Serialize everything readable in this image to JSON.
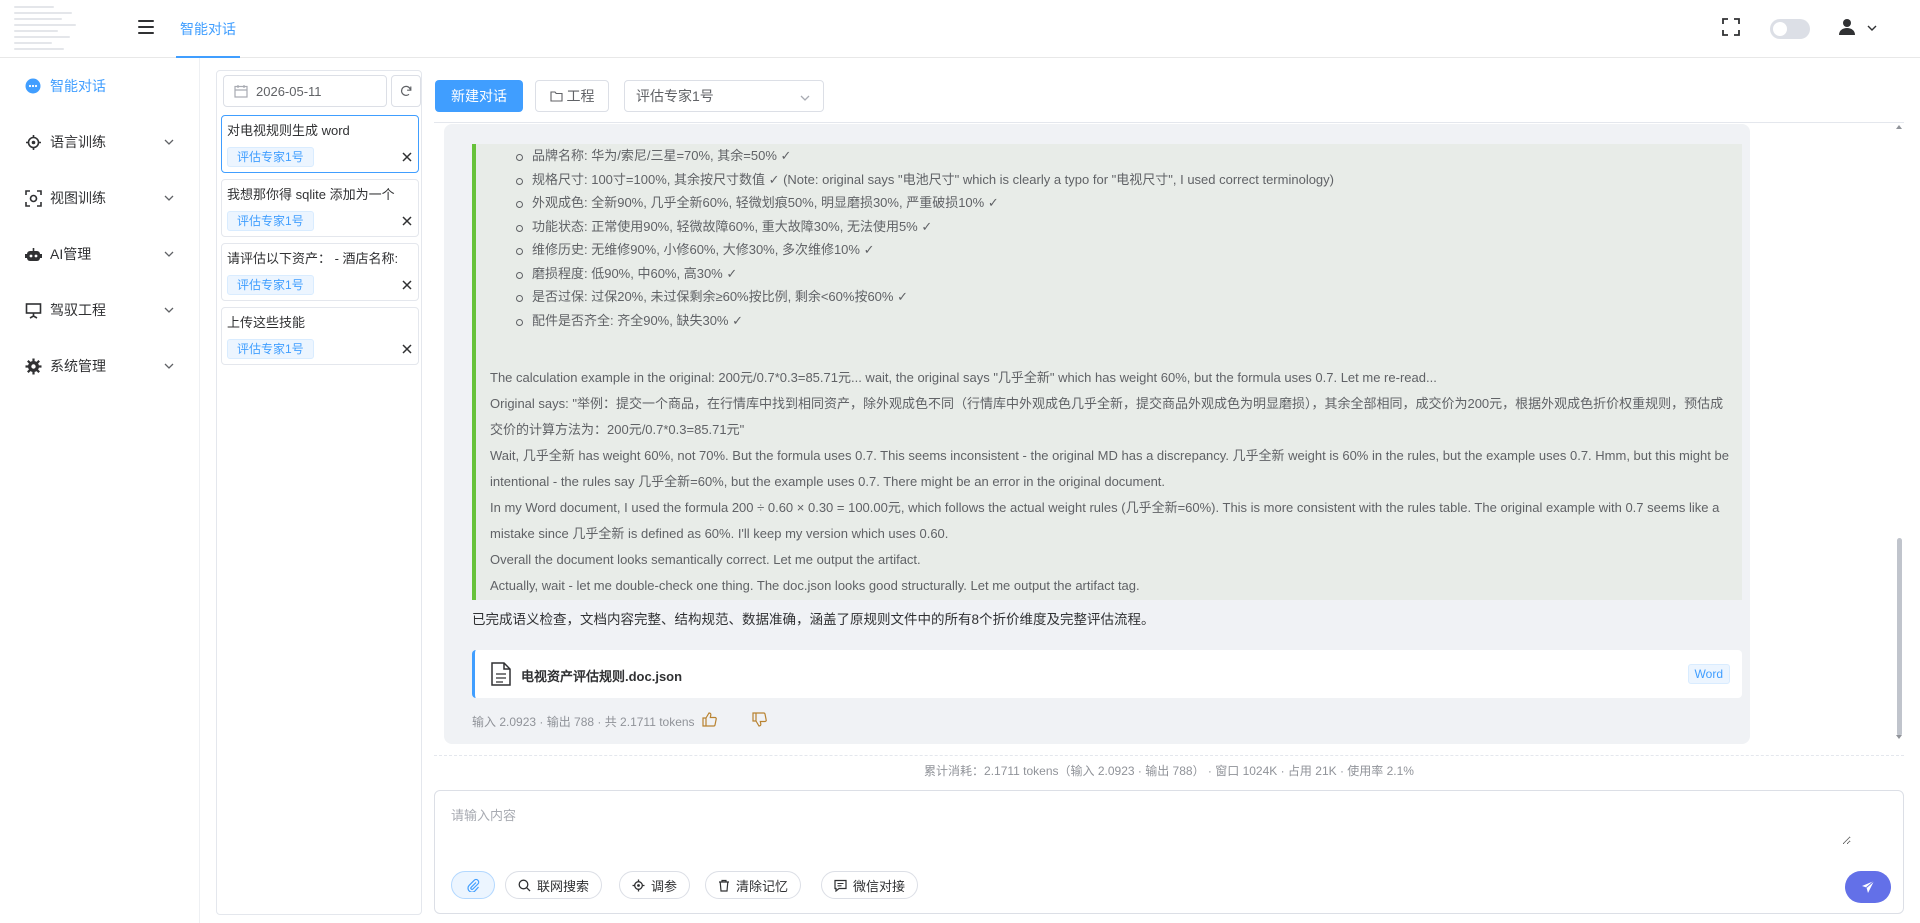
{
  "header": {
    "active_tab": "智能对话"
  },
  "sidebar": {
    "items": [
      {
        "label": "智能对话",
        "icon": "chat-bubble-icon"
      },
      {
        "label": "语言训练",
        "icon": "brain-gear-icon"
      },
      {
        "label": "视图训练",
        "icon": "scan-icon"
      },
      {
        "label": "AI管理",
        "icon": "robot-icon"
      },
      {
        "label": "驾驭工程",
        "icon": "presentation-icon"
      },
      {
        "label": "系统管理",
        "icon": "gear-icon"
      }
    ]
  },
  "conversations": {
    "date": "2026-05-11",
    "items": [
      {
        "title": "对电视规则生成 word",
        "tag": "评估专家1号"
      },
      {
        "title": "我想那你得 sqlite 添加为一个",
        "tag": "评估专家1号"
      },
      {
        "title": "请评估以下资产：  - 酒店名称:",
        "tag": "评估专家1号"
      },
      {
        "title": "上传这些技能",
        "tag": "评估专家1号"
      }
    ]
  },
  "toolbar": {
    "new_chat_label": "新建对话",
    "project_label": "工程",
    "expert_selected": "评估专家1号"
  },
  "message": {
    "thinking_bullets": [
      "品牌名称: 华为/索尼/三星=70%, 其余=50% ✓",
      "规格尺寸: 100寸=100%, 其余按尺寸数值 ✓ (Note: original says \"电池尺寸\" which is clearly a typo for \"电视尺寸\", I used correct terminology)",
      "外观成色: 全新90%, 几乎全新60%, 轻微划痕50%, 明显磨损30%, 严重破损10% ✓",
      "功能状态: 正常使用90%, 轻微故障60%, 重大故障30%, 无法使用5% ✓",
      "维修历史: 无维修90%, 小修60%, 大修30%, 多次维修10% ✓",
      "磨损程度: 低90%, 中60%, 高30% ✓",
      "是否过保: 过保20%, 未过保剩余≥60%按比例, 剩余<60%按60% ✓",
      "配件是否齐全: 齐全90%, 缺失30% ✓"
    ],
    "thinking_paragraphs": [
      "The calculation example in the original: 200元/0.7*0.3=85.71元... wait, the original says \"几乎全新\" which has weight 60%, but the formula uses 0.7. Let me re-read...",
      "Original says: \"举例：提交一个商品，在行情库中找到相同资产，除外观成色不同（行情库中外观成色几乎全新，提交商品外观成色为明显磨损），其余全部相同，成交价为200元，根据外观成色折价权重规则，预估成交价的计算方法为：200元/0.7*0.3=85.71元\"",
      "Wait, 几乎全新 has weight 60%, not 70%. But the formula uses 0.7. This seems inconsistent - the original MD has a discrepancy. 几乎全新 weight is 60% in the rules, but the example uses 0.7. Hmm, but this might be intentional - the rules say 几乎全新=60%, but the example uses 0.7. There might be an error in the original document.",
      "In my Word document, I used the formula 200 ÷ 0.60 × 0.30 = 100.00元, which follows the actual weight rules (几乎全新=60%). This is more consistent with the rules table. The original example with 0.7 seems like a mistake since 几乎全新 is defined as 60%. I'll keep my version which uses 0.60.",
      "Overall the document looks semantically correct. Let me output the artifact.",
      "Actually, wait - let me double-check one thing. The doc.json looks good structurally. Let me output the artifact tag."
    ],
    "final_text": "已完成语义检查，文档内容完整、结构规范、数据准确，涵盖了原规则文件中的所有8个折价维度及完整评估流程。",
    "file_name": "电视资产评估规则.doc.json",
    "file_tag": "Word",
    "token_stats": "输入 2.0923 · 输出 788 · 共 2.1711 tokens"
  },
  "usage": {
    "summary": "累计消耗：2.1711 tokens（输入 2.0923 · 输出 788） · 窗口 1024K · 占用 21K · 使用率 2.1%"
  },
  "composer": {
    "placeholder": "请输入内容",
    "chips": [
      "联网搜索",
      "调参",
      "清除记忆",
      "微信对接"
    ]
  }
}
